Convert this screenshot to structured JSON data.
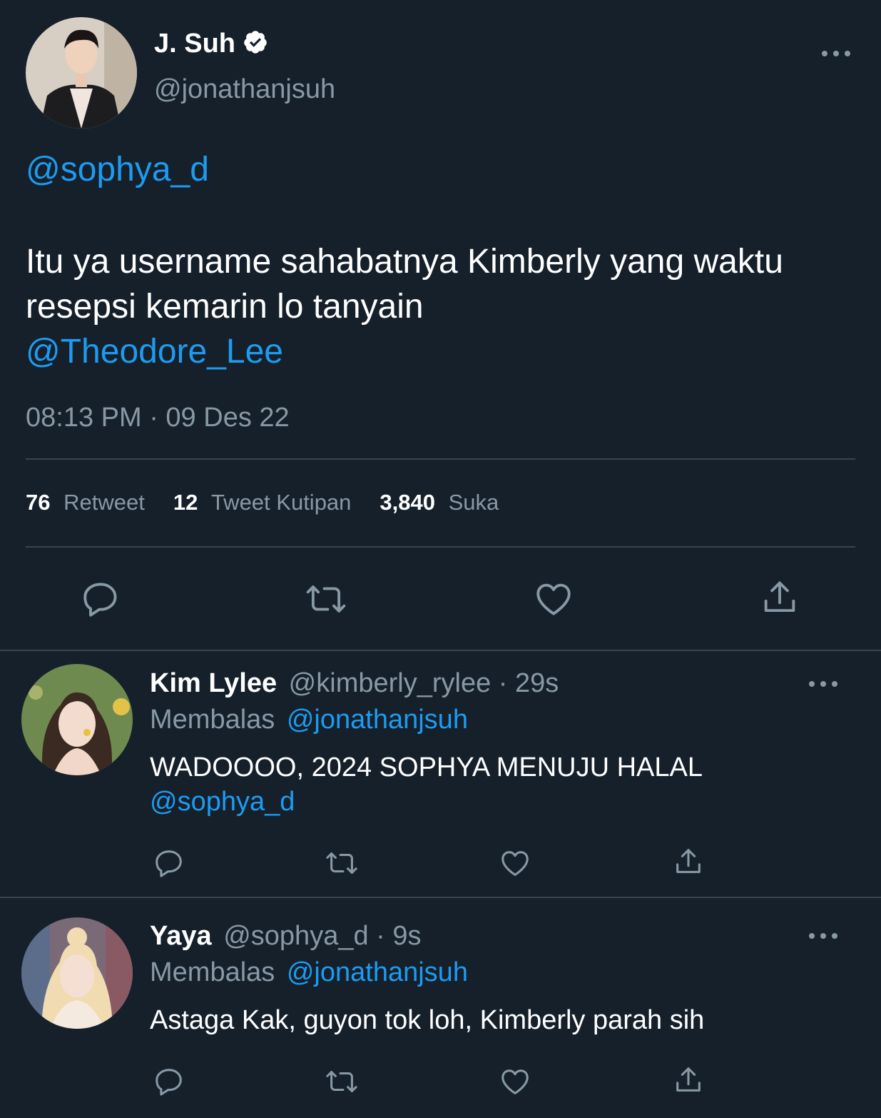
{
  "main_tweet": {
    "name": "J. Suh",
    "handle": "@jonathanjsuh",
    "mention_1": "@sophya_d",
    "body": "Itu ya username sahabatnya Kimberly yang waktu resepsi kemarin lo tanyain",
    "mention_2": "@Theodore_Lee",
    "timestamp": "08:13 PM · 09 Des 22",
    "stats": {
      "retweet_count": "76",
      "retweet_label": "Retweet",
      "quote_count": "12",
      "quote_label": "Tweet Kutipan",
      "like_count": "3,840",
      "like_label": "Suka"
    }
  },
  "replies": [
    {
      "name": "Kim Lylee",
      "handle": "@kimberly_rylee",
      "time": "· 29s",
      "replying_prefix": "Membalas",
      "replying_to": "@jonathanjsuh",
      "text": "WADOOOO, 2024 SOPHYA MENUJU HALAL",
      "mention": "@sophya_d"
    },
    {
      "name": "Yaya",
      "handle": "@sophya_d",
      "time": "· 9s",
      "replying_prefix": "Membalas",
      "replying_to": "@jonathanjsuh",
      "text": "Astaga Kak, guyon tok loh, Kimberly parah sih",
      "mention": ""
    }
  ],
  "icons": {
    "reply": "reply-icon",
    "retweet": "retweet-icon",
    "like": "heart-icon",
    "share": "share-icon",
    "more": "more-icon",
    "verified": "verified-badge-icon"
  },
  "colors": {
    "background": "#15202b",
    "link": "#1d9bf0",
    "muted": "#8899a6",
    "divider": "#38444d"
  }
}
